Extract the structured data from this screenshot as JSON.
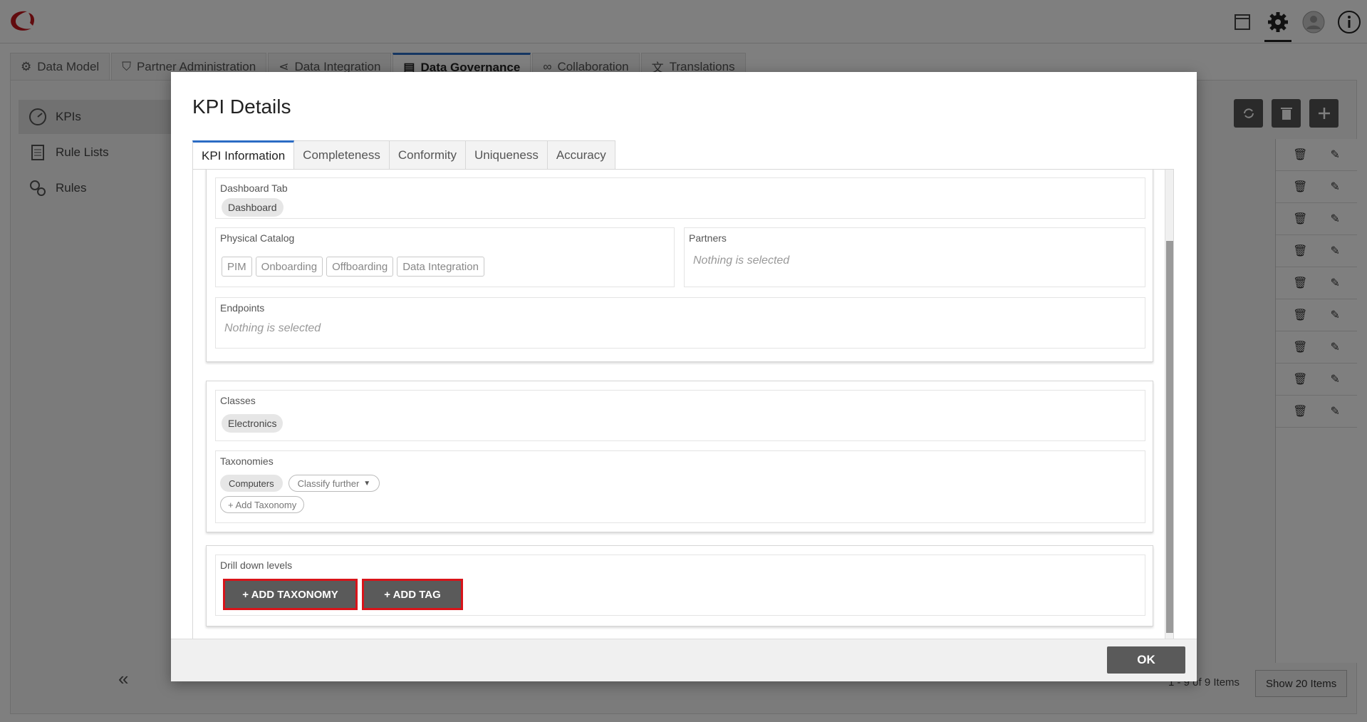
{
  "main_tabs": [
    {
      "label": "Data Model",
      "icon": "data-model-icon"
    },
    {
      "label": "Partner Administration",
      "icon": "shield-icon"
    },
    {
      "label": "Data Integration",
      "icon": "share-icon"
    },
    {
      "label": "Data Governance",
      "icon": "document-icon"
    },
    {
      "label": "Collaboration",
      "icon": "link-icon"
    },
    {
      "label": "Translations",
      "icon": "translate-icon"
    }
  ],
  "sidebar": {
    "items": [
      {
        "label": "KPIs",
        "icon": "gauge-icon"
      },
      {
        "label": "Rule Lists",
        "icon": "list-icon"
      },
      {
        "label": "Rules",
        "icon": "gears-icon"
      }
    ]
  },
  "pager": {
    "info": "1 - 9 of 9 Items",
    "show_label": "Show 20 Items"
  },
  "modal": {
    "title": "KPI Details",
    "tabs": [
      "KPI Information",
      "Completeness",
      "Conformity",
      "Uniqueness",
      "Accuracy"
    ],
    "fields": {
      "dashboard_tab": {
        "label": "Dashboard Tab",
        "value": "Dashboard"
      },
      "physical_catalog": {
        "label": "Physical Catalog",
        "values": [
          "PIM",
          "Onboarding",
          "Offboarding",
          "Data Integration"
        ]
      },
      "partners": {
        "label": "Partners",
        "empty": "Nothing is selected"
      },
      "endpoints": {
        "label": "Endpoints",
        "empty": "Nothing is selected"
      },
      "classes": {
        "label": "Classes",
        "value": "Electronics"
      },
      "taxonomies": {
        "label": "Taxonomies",
        "value": "Computers",
        "classify": "Classify further",
        "add": "+ Add Taxonomy"
      },
      "drill_down": {
        "label": "Drill down levels",
        "add_taxonomy": "+ ADD TAXONOMY",
        "add_tag": "+ ADD TAG"
      }
    },
    "ok_label": "OK"
  },
  "colors": {
    "accent": "#2b6cc4",
    "highlight": "#d8141a",
    "dark_button": "#5a5a5a"
  }
}
